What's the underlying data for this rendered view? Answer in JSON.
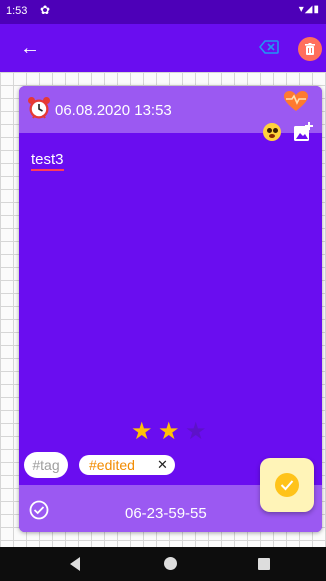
{
  "status_bar": {
    "time": "1:53"
  },
  "appbar": {
    "colors": {
      "primary": "#6a0df0",
      "status": "#4d00b8"
    }
  },
  "note": {
    "datetime": "06.08.2020 13:53",
    "text": "test3",
    "rating": {
      "value": 2,
      "max": 3
    },
    "tag_placeholder": "#tag",
    "tags": [
      {
        "label": "#edited"
      }
    ],
    "footer_code": "06-23-59-55"
  },
  "icons": {
    "back": "arrow-back-icon",
    "clear": "backspace-icon",
    "delete": "trash-icon",
    "alarm": "alarm-clock-icon",
    "favorite": "heart-icon",
    "emoji": "emoji-icon",
    "add_image": "add-image-icon",
    "done": "check-circle-icon",
    "save": "check-icon"
  }
}
